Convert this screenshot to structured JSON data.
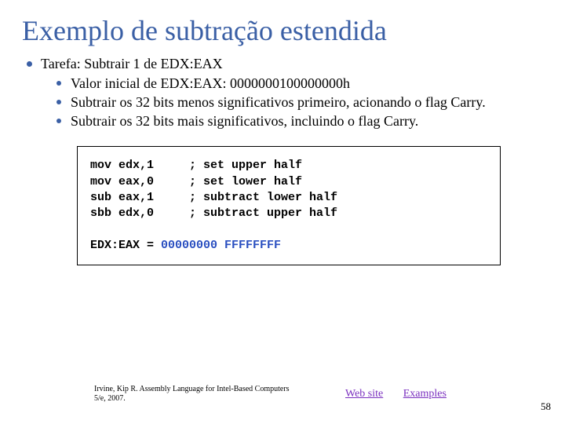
{
  "title": "Exemplo de subtração estendida",
  "task": "Tarefa: Subtrair 1 de EDX:EAX",
  "sub_items": [
    "Valor inicial de EDX:EAX: 0000000100000000h",
    "Subtrair os  32 bits  menos significativos primeiro, acionando o flag Carry.",
    "Subtrair os 32 bits mais significativos, incluindo o flag Carry."
  ],
  "code_lines": [
    "mov edx,1     ; set upper half",
    "mov eax,0     ; set lower half",
    "sub eax,1     ; subtract lower half",
    "sbb edx,0     ; subtract upper half"
  ],
  "result_prefix": "EDX:EAX = ",
  "result_value": "00000000 FFFFFFFF",
  "citation": "Irvine, Kip R. Assembly Language for Intel-Based Computers 5/e, 2007.",
  "link1": "Web site",
  "link2": "Examples",
  "page_number": "58"
}
